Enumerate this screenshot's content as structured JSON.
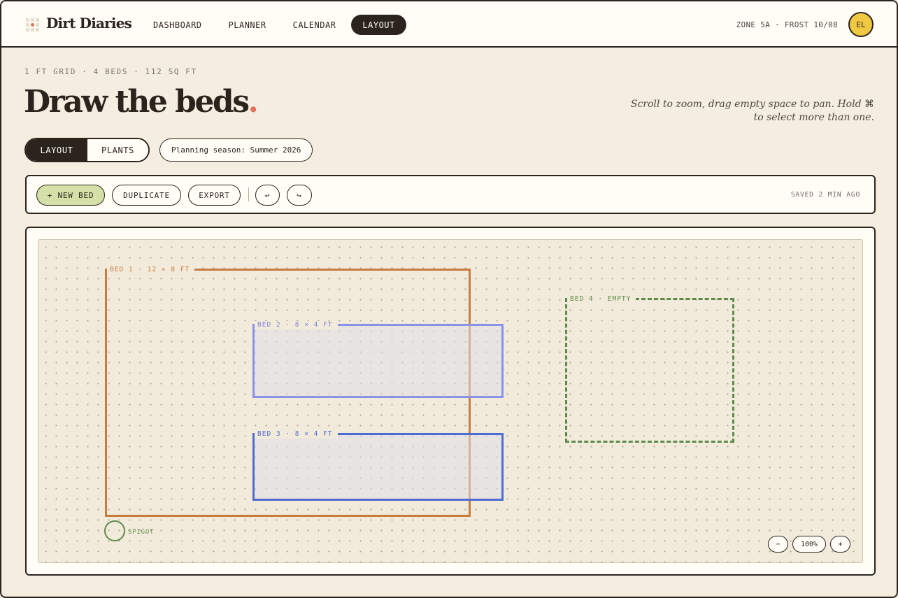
{
  "app": {
    "brand": "Dirt Diaries",
    "logo_icon": "seed-grid-icon"
  },
  "nav": {
    "items": [
      {
        "label": "DASHBOARD"
      },
      {
        "label": "PLANNER"
      },
      {
        "label": "CALENDAR"
      },
      {
        "label": "LAYOUT"
      }
    ],
    "active": "LAYOUT"
  },
  "status": {
    "zone": "ZONE 5A · FROST 10/08",
    "avatar_initials": "EL"
  },
  "header": {
    "meta": "1 FT GRID · 4 BEDS · 112 SQ FT",
    "title": "Draw the beds",
    "title_dot": ".",
    "hint": "Scroll to zoom, drag empty space to pan. Hold ⌘ to select more than one."
  },
  "view_toggle": {
    "layout_label": "LAYOUT",
    "plants_label": "PLANTS",
    "active": "LAYOUT"
  },
  "season": {
    "label": "Planning season: Summer 2026"
  },
  "toolbar": {
    "new_bed": "+ NEW BED",
    "duplicate": "DUPLICATE",
    "export": "EXPORT",
    "undo_icon": "↩",
    "redo_icon": "↪",
    "saved": "SAVED 2 MIN AGO"
  },
  "beds": [
    {
      "label": "BED 1 · 12 × 8 FT",
      "color": "#c87d3d"
    },
    {
      "label": "BED 2 · 8 × 4 FT",
      "color": "#8a92e8"
    },
    {
      "label": "BED 3 · 8 × 4 FT",
      "color": "#4f6cd0"
    },
    {
      "label": "BED 4 · EMPTY",
      "color": "#5c8a4a"
    }
  ],
  "spigot": {
    "label": "SPIGOT"
  },
  "zoom": {
    "minus": "−",
    "level": "100%",
    "plus": "+"
  },
  "colors": {
    "accent_dot": "#e0735a",
    "primary_button": "#d5e0a8",
    "avatar": "#f1c842",
    "ink": "#2a241d"
  }
}
